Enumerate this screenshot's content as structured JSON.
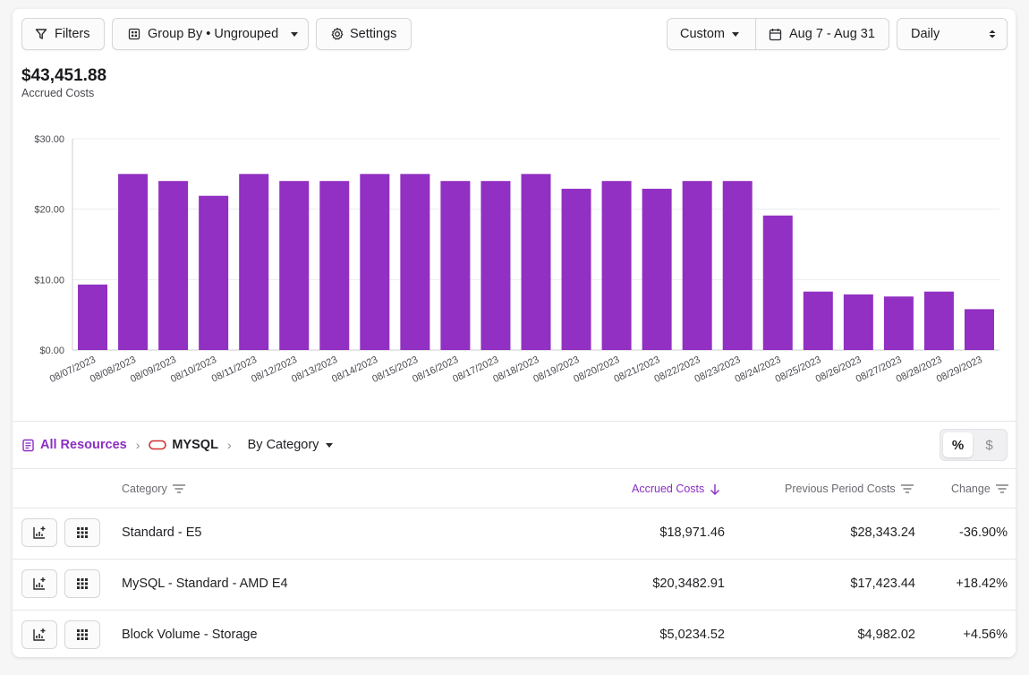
{
  "toolbar": {
    "filters_label": "Filters",
    "group_by_label": "Group By • Ungrouped",
    "settings_label": "Settings",
    "range_preset_label": "Custom",
    "date_range_label": "Aug 7 - Aug 31",
    "granularity_label": "Daily"
  },
  "summary": {
    "total": "$43,451.88",
    "total_label": "Accrued Costs"
  },
  "chart_data": {
    "type": "bar",
    "categories": [
      "08/07/2023",
      "08/08/2023",
      "08/09/2023",
      "08/10/2023",
      "08/11/2023",
      "08/12/2023",
      "08/13/2023",
      "08/14/2023",
      "08/15/2023",
      "08/16/2023",
      "08/17/2023",
      "08/18/2023",
      "08/19/2023",
      "08/20/2023",
      "08/21/2023",
      "08/22/2023",
      "08/23/2023",
      "08/24/2023",
      "08/25/2023",
      "08/26/2023",
      "08/27/2023",
      "08/28/2023",
      "08/29/2023"
    ],
    "values": [
      9.3,
      25,
      24,
      21.9,
      25,
      24,
      24,
      25,
      25,
      24,
      24,
      25,
      22.9,
      24,
      22.9,
      24,
      24,
      19.1,
      8.3,
      7.9,
      7.6,
      8.3,
      5.8
    ],
    "yticks": [
      "$0.00",
      "$10.00",
      "$20.00",
      "$30.00"
    ],
    "ylim": [
      0,
      30
    ],
    "bar_color": "#9130c2",
    "grid": true
  },
  "breadcrumb": {
    "root_label": "All Resources",
    "current_label": "MYSQL",
    "group_label": "By Category"
  },
  "view_toggle": {
    "percent_label": "%",
    "dollar_label": "$",
    "active": "percent"
  },
  "table": {
    "headers": {
      "category": "Category",
      "accrued": "Accrued Costs",
      "previous": "Previous Period Costs",
      "change": "Change"
    },
    "rows": [
      {
        "category": "Standard - E5",
        "accrued": "$18,971.46",
        "previous": "$28,343.24",
        "change": "-36.90%"
      },
      {
        "category": "MySQL - Standard - AMD E4",
        "accrued": "$20,3482.91",
        "previous": "$17,423.44",
        "change": "+18.42%"
      },
      {
        "category": "Block Volume - Storage",
        "accrued": "$5,0234.52",
        "previous": "$4,982.02",
        "change": "+4.56%"
      }
    ]
  },
  "colors": {
    "accent": "#8b2fc0",
    "bar": "#9130c2",
    "mysql_icon": "#d33030"
  },
  "icons": {
    "filters": "filter-icon",
    "group_by": "grid-icon",
    "settings": "gear-icon",
    "calendar": "calendar-icon",
    "all_resources": "document-list-icon",
    "mysql": "database-oval-icon",
    "row_chart": "chart-add-icon",
    "row_grid": "dots-grid-icon"
  }
}
